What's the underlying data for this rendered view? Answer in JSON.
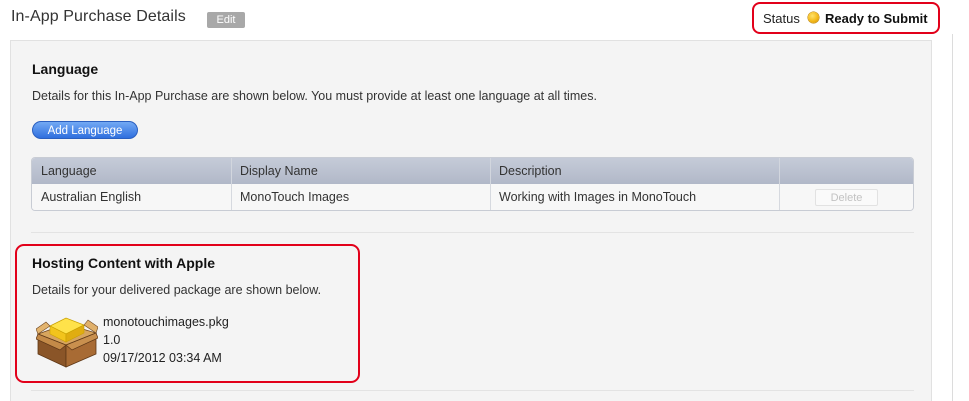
{
  "header": {
    "title": "In-App Purchase Details",
    "edit_label": "Edit",
    "status_label": "Status",
    "status_value": "Ready to Submit",
    "status_color": "#f3b81a"
  },
  "language": {
    "title": "Language",
    "description": "Details for this In-App Purchase are shown below. You must provide at least one language at all times.",
    "add_button_label": "Add Language",
    "table": {
      "columns": [
        "Language",
        "Display Name",
        "Description",
        ""
      ],
      "rows": [
        {
          "language": "Australian English",
          "display_name": "MonoTouch Images",
          "description": "Working with Images in MonoTouch",
          "action_label": "Delete"
        }
      ]
    }
  },
  "hosting": {
    "title": "Hosting Content with Apple",
    "description": "Details for your delivered package are shown below.",
    "package": {
      "icon": "package-icon",
      "filename": "monotouchimages.pkg",
      "version": "1.0",
      "date": "09/17/2012 03:34 AM"
    }
  },
  "colors": {
    "highlight": "#e2001a",
    "button_blue": "#2f6fde"
  }
}
